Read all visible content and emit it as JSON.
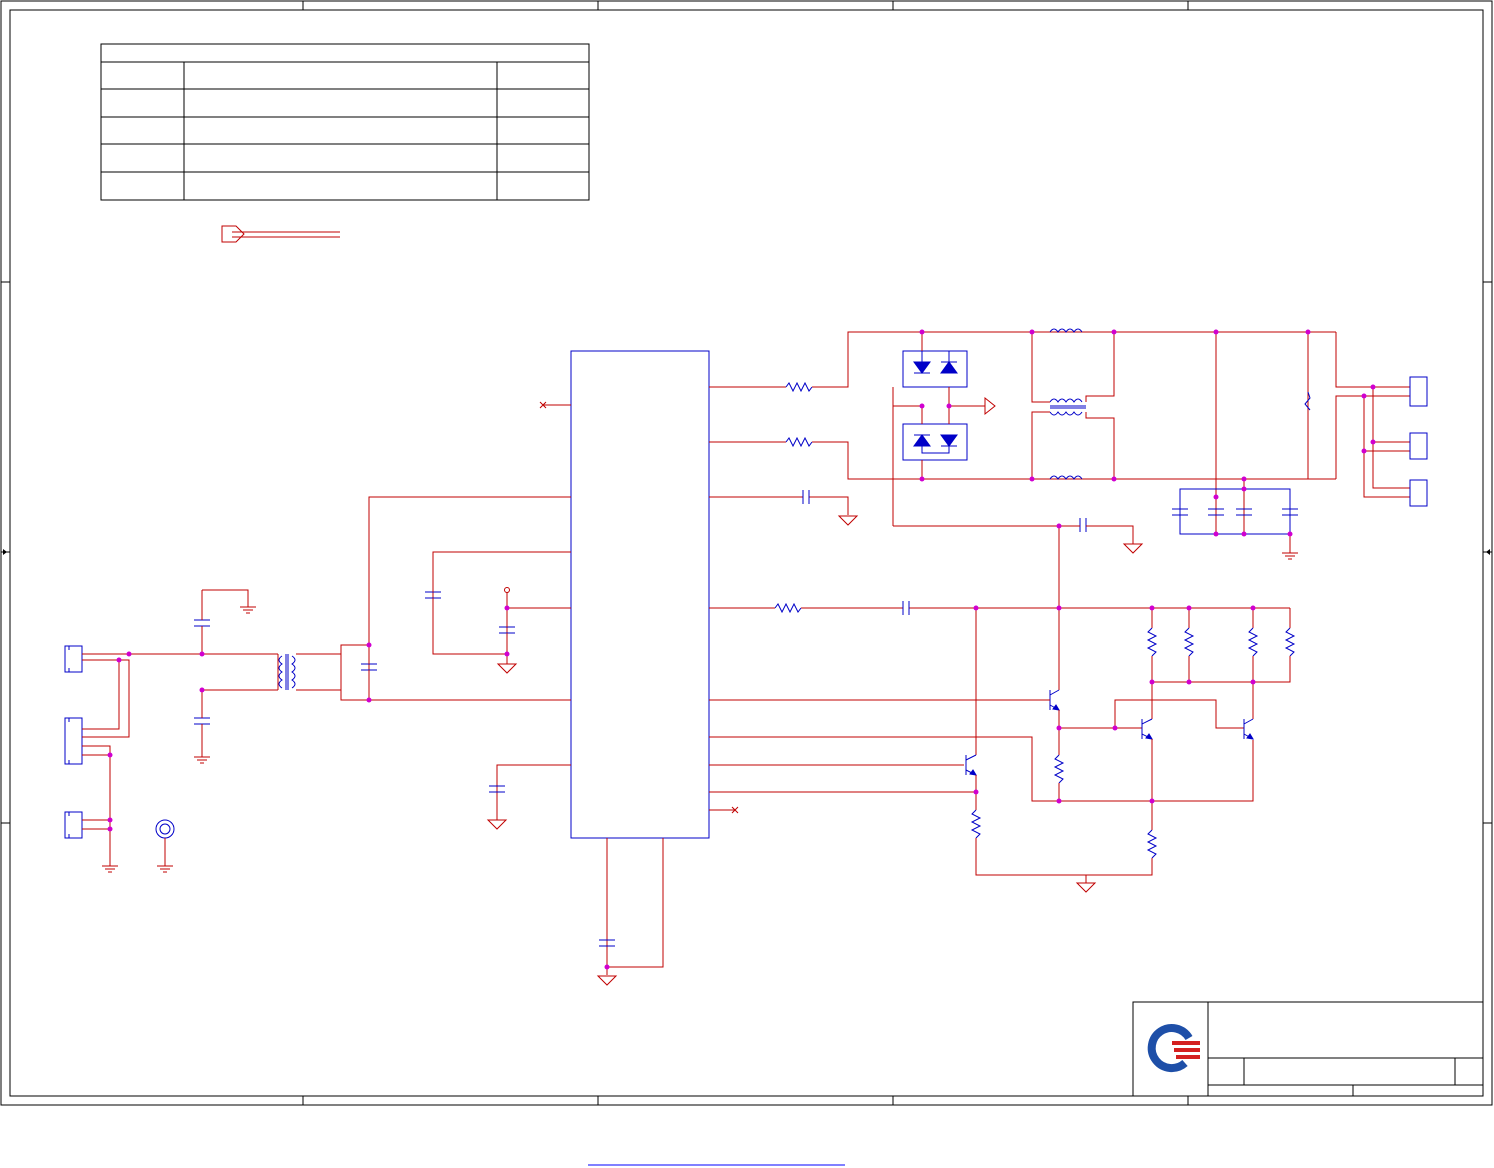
{
  "sheet": {
    "revision_table": {
      "rows": 5,
      "columns": 3
    },
    "title_block": {
      "logo": "company-logo"
    },
    "colors": {
      "wire": "#c00000",
      "component": "#0000c8",
      "junction": "#d000d0",
      "frame": "#000000",
      "link": "#0000ff"
    }
  }
}
